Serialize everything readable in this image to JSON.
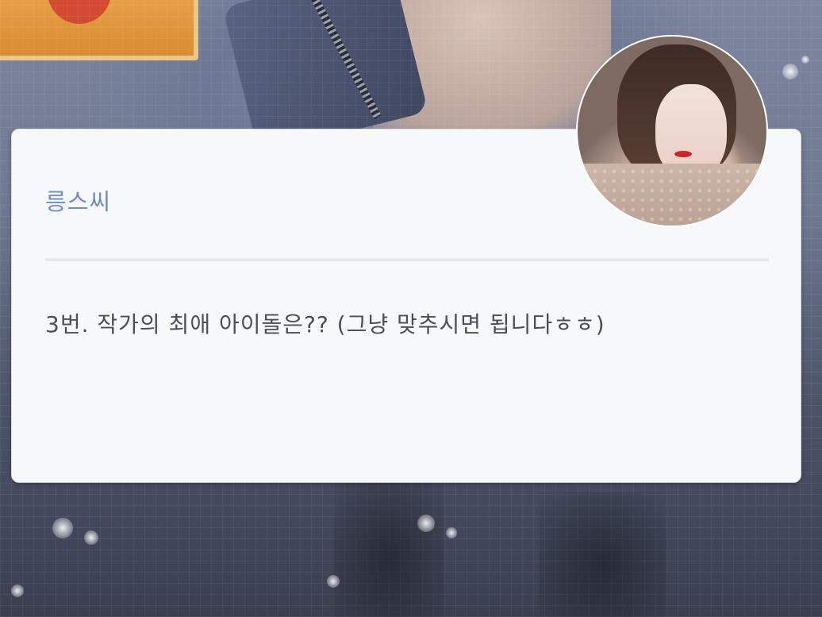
{
  "post": {
    "author": "릉스씨",
    "message": "3번. 작가의 최애 아이돌은?? (그냥 맞추시면 됩니다ㅎㅎ)"
  },
  "icons": {
    "avatar": "profile-avatar-photo"
  },
  "colors": {
    "author_name": "#6f8ad0",
    "message_text": "#4b4f57",
    "card_background": "#f7f8fa",
    "divider": "#e6e8ec"
  }
}
